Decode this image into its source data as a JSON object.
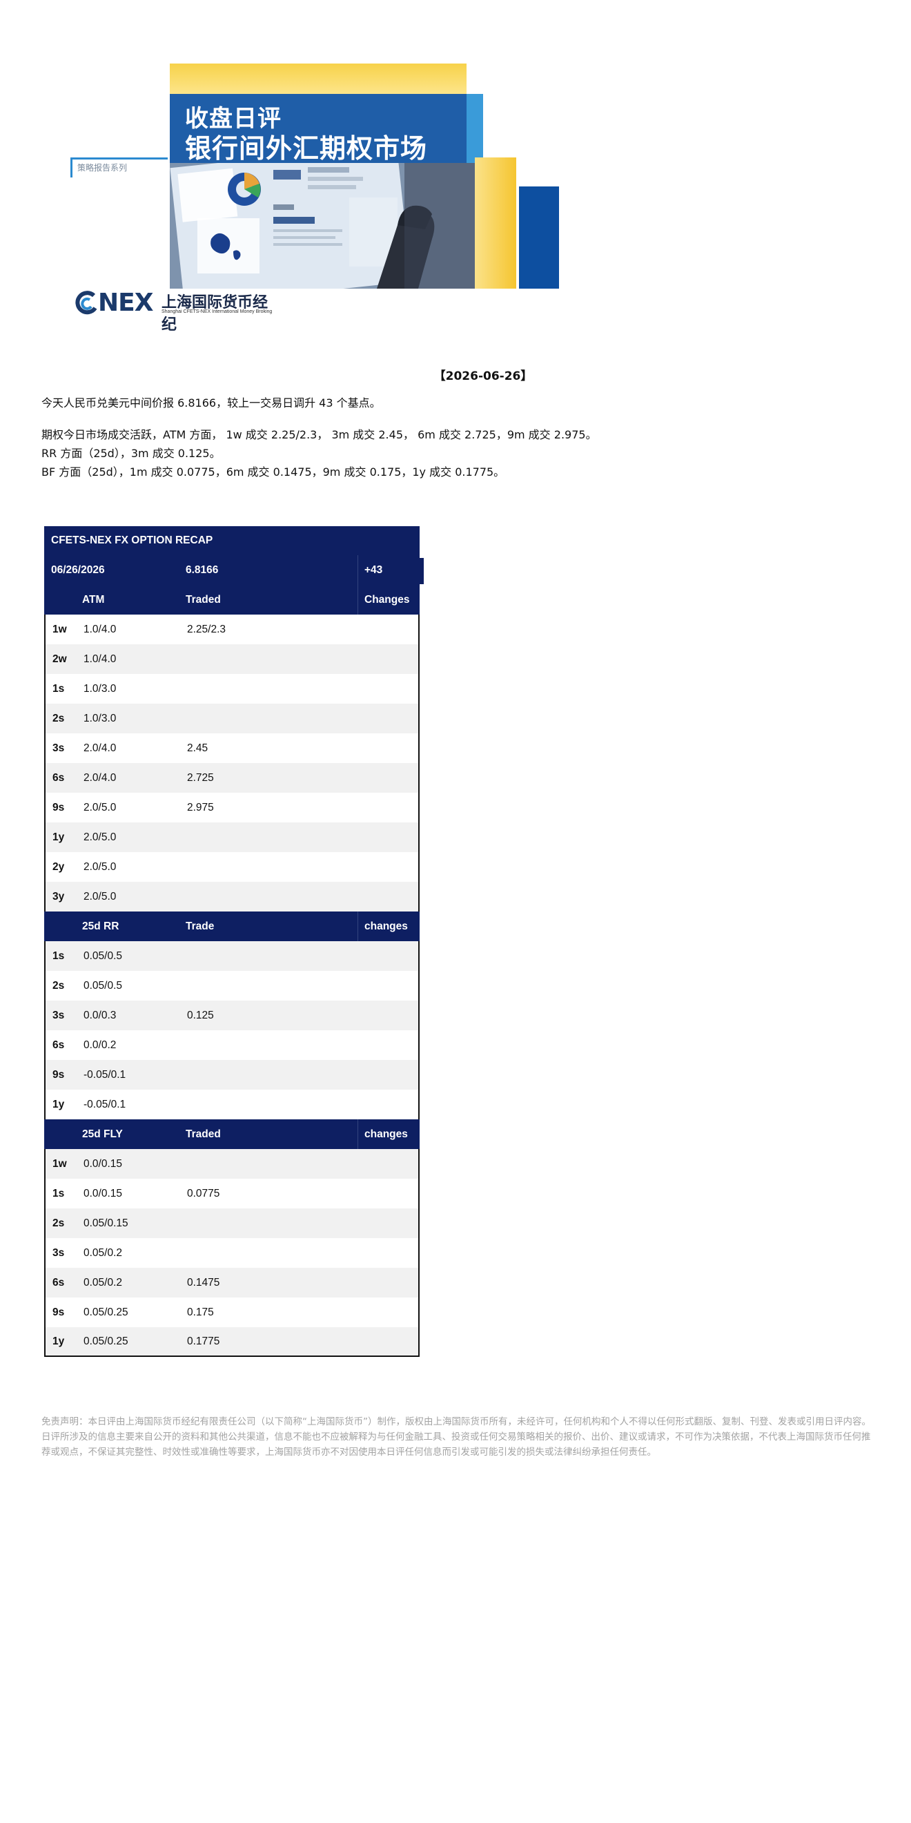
{
  "banner": {
    "title_line1": "收盘日评",
    "title_line2": "银行间外汇期权市场",
    "series_label": "策略报告系列",
    "logo_nex": "NEX",
    "logo_cn": "上海国际货币经纪",
    "logo_en": "Shanghai CFETS-NEX International Money Broking"
  },
  "report_date": "【2026-06-26】",
  "paragraphs": {
    "fixing": "今天人民币兑美元中间价报 6.8166，较上一交易日调升 43 个基点。",
    "atm": "期权今日市场成交活跃，ATM 方面， 1w 成交 2.25/2.3， 3m 成交 2.45， 6m 成交 2.725，9m 成交 2.975。",
    "rr": "RR 方面（25d），3m 成交 0.125。",
    "bf": "BF 方面（25d），1m 成交 0.0775，6m 成交 0.1475，9m 成交 0.175，1y 成交 0.1775。"
  },
  "table": {
    "title": "CFETS-NEX FX OPTION RECAP",
    "date": "06/26/2026",
    "fixing": "6.8166",
    "change": "+43",
    "atm_header": {
      "col1": "",
      "col2": "ATM",
      "col3": "Traded",
      "col4": "Changes"
    },
    "atm_rows": [
      {
        "tenor": "1w",
        "quote": "1.0/4.0",
        "traded": "2.25/2.3",
        "change": ""
      },
      {
        "tenor": "2w",
        "quote": "1.0/4.0",
        "traded": "",
        "change": ""
      },
      {
        "tenor": "1s",
        "quote": "1.0/3.0",
        "traded": "",
        "change": ""
      },
      {
        "tenor": "2s",
        "quote": "1.0/3.0",
        "traded": "",
        "change": ""
      },
      {
        "tenor": "3s",
        "quote": "2.0/4.0",
        "traded": "2.45",
        "change": ""
      },
      {
        "tenor": "6s",
        "quote": "2.0/4.0",
        "traded": "2.725",
        "change": ""
      },
      {
        "tenor": "9s",
        "quote": "2.0/5.0",
        "traded": "2.975",
        "change": ""
      },
      {
        "tenor": "1y",
        "quote": "2.0/5.0",
        "traded": "",
        "change": ""
      },
      {
        "tenor": "2y",
        "quote": "2.0/5.0",
        "traded": "",
        "change": ""
      },
      {
        "tenor": "3y",
        "quote": "2.0/5.0",
        "traded": "",
        "change": ""
      }
    ],
    "rr_header": {
      "col1": "",
      "col2": "25d RR",
      "col3": "Trade",
      "col4": "changes"
    },
    "rr_rows": [
      {
        "tenor": "1s",
        "quote": "0.05/0.5",
        "traded": "",
        "change": ""
      },
      {
        "tenor": "2s",
        "quote": "0.05/0.5",
        "traded": "",
        "change": ""
      },
      {
        "tenor": "3s",
        "quote": "0.0/0.3",
        "traded": "0.125",
        "change": ""
      },
      {
        "tenor": "6s",
        "quote": "0.0/0.2",
        "traded": "",
        "change": ""
      },
      {
        "tenor": "9s",
        "quote": "-0.05/0.1",
        "traded": "",
        "change": ""
      },
      {
        "tenor": "1y",
        "quote": "-0.05/0.1",
        "traded": "",
        "change": ""
      }
    ],
    "fly_header": {
      "col1": "",
      "col2": "25d FLY",
      "col3": "Traded",
      "col4": "changes"
    },
    "fly_rows": [
      {
        "tenor": "1w",
        "quote": "0.0/0.15",
        "traded": "",
        "change": ""
      },
      {
        "tenor": "1s",
        "quote": "0.0/0.15",
        "traded": "0.0775",
        "change": ""
      },
      {
        "tenor": "2s",
        "quote": "0.05/0.15",
        "traded": "",
        "change": ""
      },
      {
        "tenor": "3s",
        "quote": "0.05/0.2",
        "traded": "",
        "change": ""
      },
      {
        "tenor": "6s",
        "quote": "0.05/0.2",
        "traded": "0.1475",
        "change": ""
      },
      {
        "tenor": "9s",
        "quote": "0.05/0.25",
        "traded": "0.175",
        "change": ""
      },
      {
        "tenor": "1y",
        "quote": "0.05/0.25",
        "traded": "0.1775",
        "change": ""
      }
    ]
  },
  "disclaimer": "免责声明：本日评由上海国际货币经纪有限责任公司（以下简称“上海国际货币”）制作，版权由上海国际货币所有，未经许可，任何机构和个人不得以任何形式翻版、复制、刊登、发表或引用日评内容。日评所涉及的信息主要来自公开的资料和其他公共渠道，信息不能也不应被解释为与任何金融工具、投资或任何交易策略相关的报价、出价、建议或请求，不可作为决策依据，不代表上海国际货币任何推荐或观点，不保证其完整性、时效性或准确性等要求，上海国际货币亦不对因使用本日评任何信息而引发或可能引发的损失或法律纠纷承担任何责任。",
  "colors": {
    "table_header_bg": "#0e1f62",
    "banner_blue": "#1f5ea8",
    "banner_yellow": "#f5c530",
    "row_alt_bg": "#f1f1f1",
    "disclaimer_text": "#a3a3a3"
  }
}
